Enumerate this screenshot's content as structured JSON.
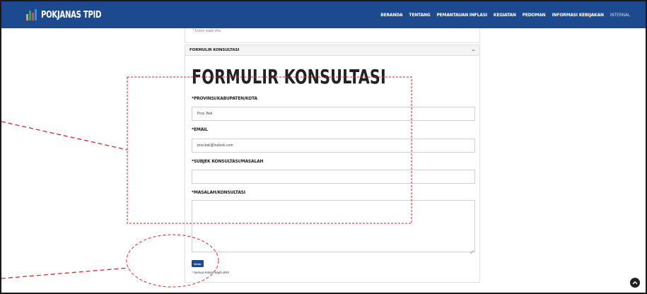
{
  "header": {
    "brand": "POKJANAS TPID",
    "brand_colors": [
      "#f3a21a",
      "#2ea84f",
      "#e64a2e",
      "#3a8fdc"
    ],
    "nav": [
      {
        "label": "BERANDA"
      },
      {
        "label": "TENTANG"
      },
      {
        "label": "PEMANTAUAN INFLASI"
      },
      {
        "label": "KEGIATAN"
      },
      {
        "label": "PEDOMAN"
      },
      {
        "label": "INFORMASI KEBIJAKAN"
      },
      {
        "label": "INTERNAL"
      }
    ]
  },
  "top_note": "* Kolom wajib diisi",
  "panel": {
    "header_title": "FORMULIR KONSULTASI",
    "collapse_symbol": "−",
    "title": "FORMULIR KONSULTASI"
  },
  "form": {
    "province_label": "*PROVINSI/KABUPATEN/KOTA",
    "province_value": "Prov. Bali",
    "email_label": "*EMAIL",
    "email_value": "prov.bali@outlook.com",
    "subject_label": "*SUBJEK KONSULTASI/MASALAH",
    "subject_value": "",
    "message_label": "*MASALAH/KONSULTASI",
    "message_value": "",
    "submit_label": "Kirim",
    "required_note": "* Semua Kolom wajib diisi!"
  },
  "colors": {
    "navbar": "#1d4a8f",
    "annotation": "#d9262b"
  },
  "icons": {
    "scroll_top": "chevron-up-icon",
    "collapse": "minus-icon"
  }
}
